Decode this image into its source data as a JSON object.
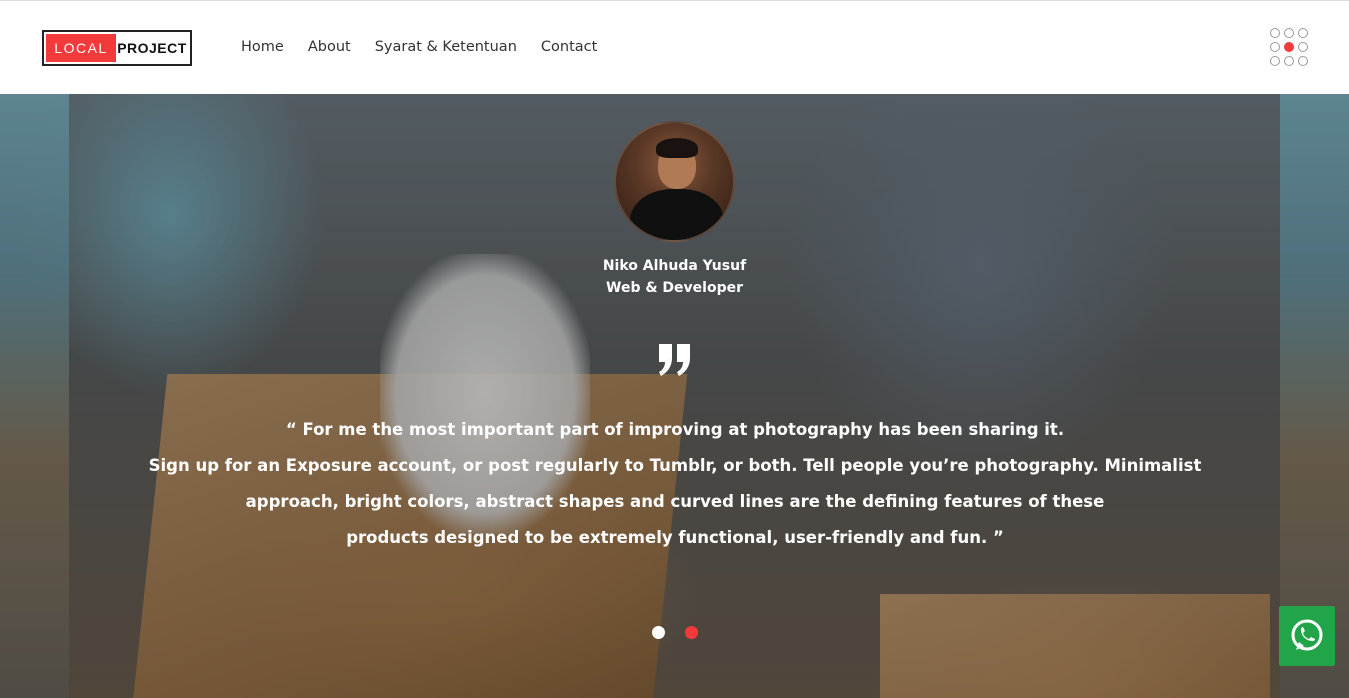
{
  "header": {
    "logo": {
      "part1": "LOCAL",
      "part2": "PROJECT"
    },
    "nav": [
      {
        "label": "Home"
      },
      {
        "label": "About"
      },
      {
        "label": "Syarat & Ketentuan"
      },
      {
        "label": "Contact"
      }
    ],
    "menu_icon": "grid-dots-icon"
  },
  "testimonial": {
    "name": "Niko Alhuda Yusuf",
    "role": "Web & Developer",
    "quote_icon": "quote-icon",
    "quote_lines": [
      "“ For me the most important part of improving at photography has been sharing it.",
      "Sign up for an Exposure account, or post regularly to Tumblr, or both. Tell people you’re photography. Minimalist",
      "approach, bright colors, abstract shapes and curved lines are the defining features of these",
      "products designed to be extremely functional, user-friendly and fun. ”"
    ]
  },
  "slider": {
    "slides": 2,
    "active_index": 1
  },
  "whatsapp": {
    "icon": "whatsapp-icon"
  },
  "colors": {
    "accent": "#f33a3a",
    "whatsapp": "#22a548"
  }
}
